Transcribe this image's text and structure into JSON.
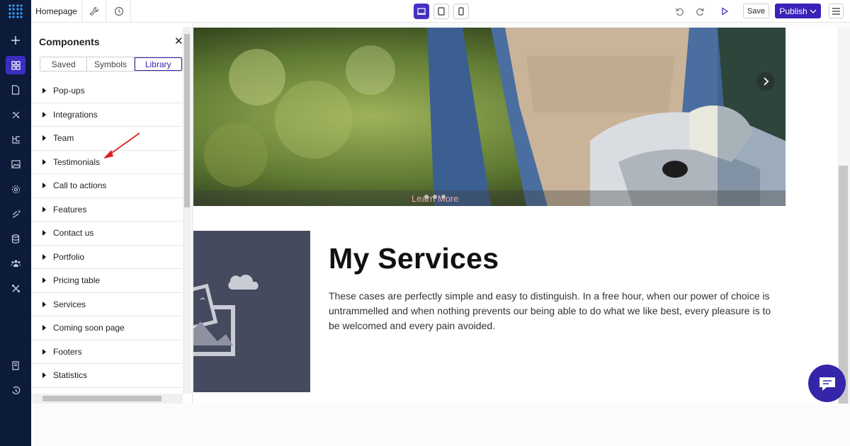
{
  "topbar": {
    "page_name": "Homepage",
    "save_label": "Save",
    "publish_label": "Publish",
    "accent": "#3a22b8"
  },
  "panel": {
    "title": "Components",
    "tabs": [
      "Saved",
      "Symbols",
      "Library"
    ],
    "active_tab": "Library",
    "items": [
      "Pop-ups",
      "Integrations",
      "Team",
      "Testimonials",
      "Call to actions",
      "Features",
      "Contact us",
      "Portfolio",
      "Pricing table",
      "Services",
      "Coming soon page",
      "Footers",
      "Statistics"
    ]
  },
  "canvas": {
    "hero_button": "Learn More",
    "services_title": "My Services",
    "services_text": "These cases are perfectly simple and easy to distinguish. In a free hour, when our power of choice is untrammelled and when nothing prevents our being able to do what we like best, every pleasure is to be welcomed and every pain avoided."
  },
  "rail_icons": [
    "plus-icon",
    "components-icon",
    "page-icon",
    "tools-icon",
    "hierarchy-icon",
    "image-icon",
    "settings-icon",
    "integrations-icon",
    "database-icon",
    "users-icon",
    "advanced-icon",
    "docs-icon",
    "history-icon"
  ]
}
